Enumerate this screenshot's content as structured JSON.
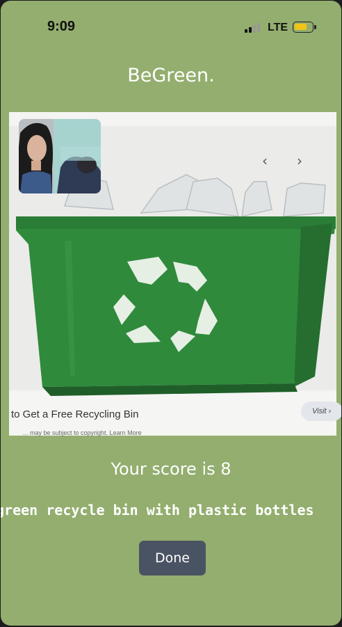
{
  "status_bar": {
    "time": "9:09",
    "network": "LTE",
    "signal_bars_active": 2,
    "signal_bars_total": 4,
    "battery_level": 0.75,
    "battery_color": "#f0c419"
  },
  "app": {
    "title": "BeGreen."
  },
  "photo": {
    "caption": "to Get a Free Recycling Bin",
    "visit_label": "Visit ›",
    "fine_print": "... may be subject to copyright. Learn More",
    "prev_icon": "chevron-left-icon",
    "next_icon": "chevron-right-icon",
    "more_icon": "more-vertical-icon"
  },
  "result": {
    "score_text": "Your score is 8",
    "description": "green recycle bin with plastic bottles"
  },
  "actions": {
    "done_label": "Done"
  },
  "colors": {
    "background": "#93ae6e",
    "bin_green": "#2f8a3c",
    "button": "#4a5363"
  }
}
